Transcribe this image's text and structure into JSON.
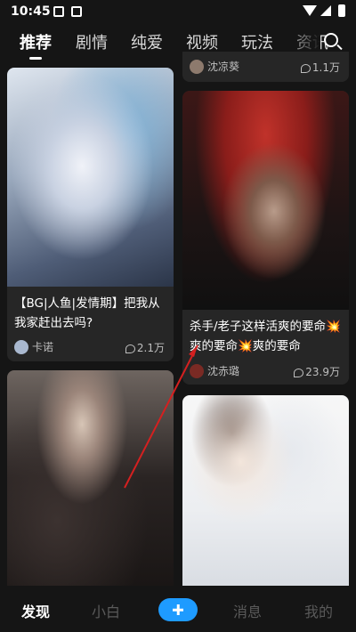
{
  "status_bar": {
    "time": "10:45"
  },
  "tabs": [
    {
      "label": "推荐"
    },
    {
      "label": "剧情"
    },
    {
      "label": "纯爱"
    },
    {
      "label": "视频"
    },
    {
      "label": "玩法"
    },
    {
      "label": "资讯"
    }
  ],
  "feed": {
    "left": [
      {
        "title": "【BG|人鱼|发情期】把我从我家赶出去吗?",
        "author": "卡诺",
        "likes": "2.1万"
      },
      {
        "title": "",
        "author": "",
        "likes": ""
      }
    ],
    "right": [
      {
        "title": "",
        "author": "沈凉葵",
        "likes": "1.1万"
      },
      {
        "title": "杀手/老子这样活爽的要命💥爽的要命💥爽的要命",
        "author": "沈赤璐",
        "likes": "23.9万"
      },
      {
        "title": "",
        "author": "",
        "likes": ""
      }
    ]
  },
  "bottom_nav": {
    "items": [
      {
        "label": "发现"
      },
      {
        "label": "小白"
      },
      {
        "label": "消息"
      },
      {
        "label": "我的"
      }
    ],
    "create_icon": "plus-icon"
  },
  "colors": {
    "accent": "#1e9bff",
    "background": "#151515",
    "card": "#262626",
    "annotation": "#d42020"
  },
  "icons": [
    "search-icon",
    "comment-icon",
    "plus-icon",
    "image-icon",
    "wifi-icon",
    "signal-icon",
    "battery-icon"
  ]
}
